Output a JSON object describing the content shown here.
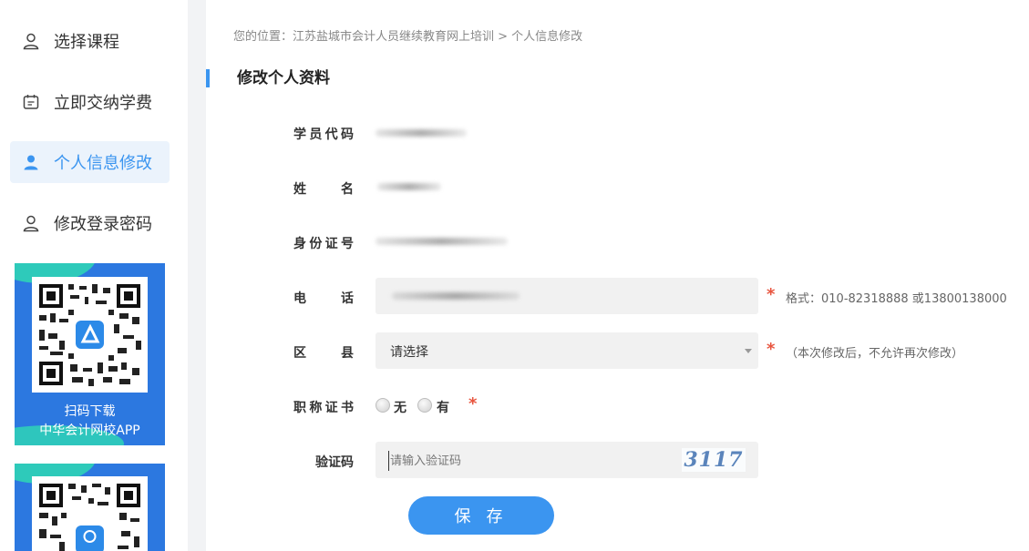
{
  "sidebar": {
    "items": [
      {
        "label": "选择课程",
        "icon": "user-icon"
      },
      {
        "label": "立即交纳学费",
        "icon": "calendar-icon"
      },
      {
        "label": "个人信息修改",
        "icon": "user-icon",
        "active": true
      },
      {
        "label": "修改登录密码",
        "icon": "user-icon"
      }
    ],
    "qr_card": {
      "line1": "扫码下载",
      "line2": "中华会计网校APP"
    }
  },
  "breadcrumb": "您的位置：江苏盐城市会计人员继续教育网上培训 > 个人信息修改",
  "section_title": "修改个人资料",
  "form": {
    "student_code_label": "学员代码",
    "name_label": "姓名",
    "id_label": "身份证号",
    "phone_label": "电话",
    "phone_hint": "格式：010-82318888 或13800138000",
    "district_label": "区县",
    "district_value": "请选择",
    "district_hint": "（本次修改后，不允许再次修改）",
    "title_cert_label": "职称证书",
    "title_cert_options": [
      "无",
      "有"
    ],
    "captcha_label": "验证码",
    "captcha_placeholder": "请输入验证码",
    "captcha_image_text": "3117",
    "required_mark": "*"
  },
  "save_button": "保 存",
  "colors": {
    "accent": "#3b95f0",
    "required": "#e8553f",
    "qr_bg": "#2c78e0"
  }
}
